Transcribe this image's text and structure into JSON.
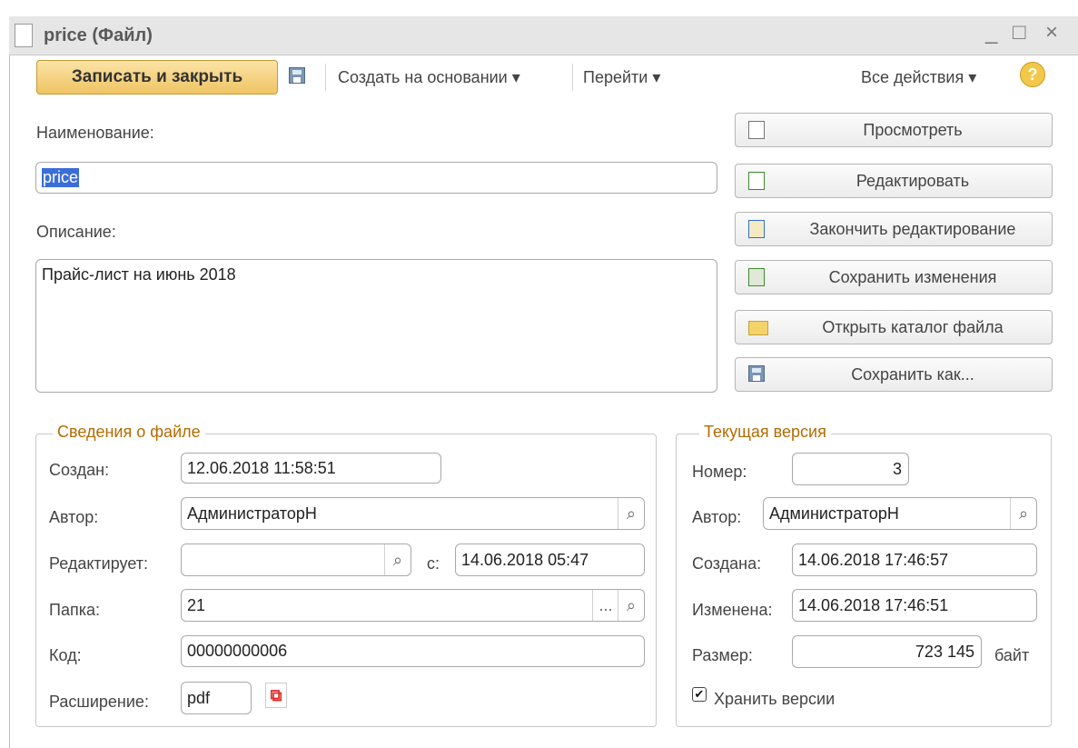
{
  "window": {
    "title": "price (Файл)",
    "minimize": "_",
    "maximize": "□",
    "close": "×"
  },
  "toolbar": {
    "save_close": "Записать и закрыть",
    "create_based": "Создать на основании ▾",
    "go_to": "Перейти ▾",
    "all_actions": "Все действия ▾",
    "help": "?"
  },
  "form": {
    "name_label": "Наименование:",
    "name_value": "price",
    "description_label": "Описание:",
    "description_value": "Прайс-лист на июнь 2018"
  },
  "side_buttons": {
    "view": "Просмотреть",
    "edit": "Редактировать",
    "finish_edit": "Закончить редактирование",
    "save_changes": "Сохранить изменения",
    "open_folder": "Открыть каталог файла",
    "save_as": "Сохранить как..."
  },
  "file_info": {
    "title": "Сведения о файле",
    "created_label": "Создан:",
    "created_value": "12.06.2018 11:58:51",
    "author_label": "Автор:",
    "author_value": "АдминистраторН",
    "editing_label": "Редактирует:",
    "editing_value": "",
    "since_label": "с:",
    "since_value": "14.06.2018 05:47",
    "folder_label": "Папка:",
    "folder_value": "21",
    "code_label": "Код:",
    "code_value": "00000000006",
    "extension_label": "Расширение:",
    "extension_value": "pdf"
  },
  "current_version": {
    "title": "Текущая версия",
    "number_label": "Номер:",
    "number_value": "3",
    "author_label": "Автор:",
    "author_value": "АдминистраторН",
    "created_label": "Создана:",
    "created_value": "14.06.2018 17:46:57",
    "changed_label": "Изменена:",
    "changed_value": "14.06.2018 17:46:51",
    "size_label": "Размер:",
    "size_value": "723 145",
    "size_unit": "байт",
    "keep_versions_label": "Хранить версии"
  },
  "icons": {
    "search": "⌕",
    "dots": "...",
    "check": "✔",
    "pdf": "⧉"
  }
}
